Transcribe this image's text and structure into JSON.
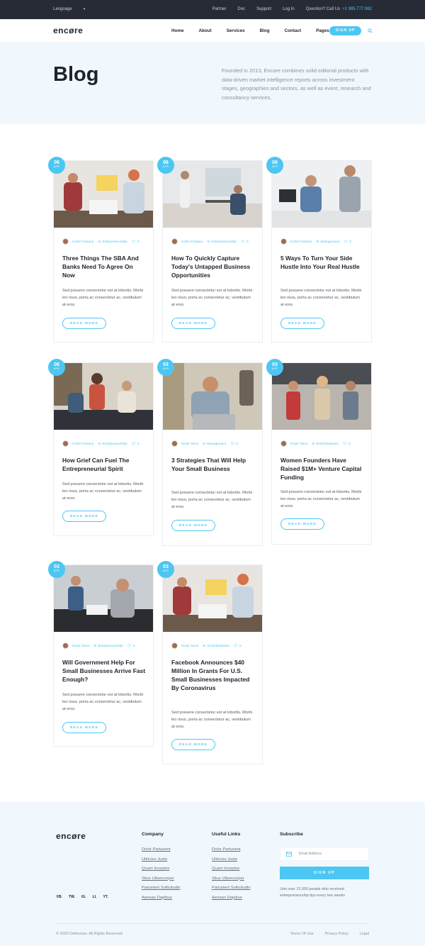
{
  "topbar": {
    "language": "Language",
    "links": [
      "Partner",
      "Doc",
      "Support",
      "Log In"
    ],
    "question": "Question? Call Us",
    "phone": "+1 985.777.982"
  },
  "header": {
    "logo": "encøre",
    "nav": [
      "Home",
      "About",
      "Services",
      "Blog",
      "Contact"
    ],
    "pages": "Pages",
    "signup": "SIGN UP"
  },
  "hero": {
    "title": "Blog",
    "description": "Founded in 2013, Encore combines solid editorial products with data-driven market intelligence reports across investment stages, geographies and sectors, as well as event, research and consultancy services."
  },
  "posts": [
    {
      "day": "06",
      "month": "APR",
      "author": "Anzhe Fontana",
      "category": "Entrepreneurship",
      "comments": "0",
      "title": "Three Things The SBA And Banks Need To Agree On Now",
      "excerpt": "Sed posuere consectetur est at lobortis. Morbi leo risus, porta ac consectetur ac, vestibulum at eros.",
      "cta": "READ MORE"
    },
    {
      "day": "06",
      "month": "APR",
      "author": "Anzhe Fontana",
      "category": "Entrepreneurship",
      "comments": "0",
      "title": "How To Quickly Capture Today's Untapped Business Opportunities",
      "excerpt": "Sed posuere consectetur est at lobortis. Morbi leo risus, porta ac consectetur ac, vestibulum at eros.",
      "cta": "READ MORE"
    },
    {
      "day": "06",
      "month": "APR",
      "author": "Anzhe Fontana",
      "category": "Management",
      "comments": "0",
      "title": "5 Ways To Turn Your Side Hustle Into Your Real Hustle",
      "excerpt": "Sed posuere consectetur est at lobortis. Morbi leo risus, porta ac consectetur ac, vestibulum at eros.",
      "cta": "READ MORE"
    },
    {
      "day": "06",
      "month": "APR",
      "author": "Anzhe Fontana",
      "category": "Entrepreneurship",
      "comments": "0",
      "title": "How Grief Can Fuel The Entrepreneurial Spirit",
      "excerpt": "Sed posuere consectetur est at lobortis. Morbi leo risus, porta ac consectetur ac, vestibulum at eros.",
      "cta": "READ MORE"
    },
    {
      "day": "03",
      "month": "APR",
      "author": "Yonas Tarus",
      "category": "Management",
      "comments": "0",
      "title": "3 Strategies That Will Help Your Small Business",
      "excerpt": "Sed posuere consectetur est at lobortis. Morbi leo risus, porta ac consectetur ac, vestibulum at eros.",
      "cta": "READ MORE"
    },
    {
      "day": "03",
      "month": "APR",
      "author": "Yonas Tarus",
      "category": "Small Business",
      "comments": "0",
      "title": "Women Founders Have Raised $1M+ Venture Capital Funding",
      "excerpt": "Sed posuere consectetur est at lobortis. Morbi leo risus, porta ac consectetur ac, vestibulum at eros.",
      "cta": "READ MORE"
    },
    {
      "day": "03",
      "month": "APR",
      "author": "Yonas Tarus",
      "category": "Entrepreneurship",
      "comments": "0",
      "title": "Will Government Help For Small Businesses Arrive Fast Enough?",
      "excerpt": "Sed posuere consectetur est at lobortis. Morbi leo risus, porta ac consectetur ac, vestibulum at eros.",
      "cta": "READ MORE"
    },
    {
      "day": "03",
      "month": "APR",
      "author": "Yonas Tarus",
      "category": "Small Business",
      "comments": "0",
      "title": "Facebook Announces $40 Million In Grants For U.S. Small Businesses Impacted By Coronavirus",
      "excerpt": "Sed posuere consectetur est at lobortis. Morbi leo risus, porta ac consectetur ac, vestibulum at eros.",
      "cta": "READ MORE"
    }
  ],
  "footer": {
    "logo": "encøre",
    "social": [
      "FB.",
      "TW.",
      "IG.",
      "LI.",
      "YT."
    ],
    "company": {
      "heading": "Company",
      "links": [
        "Dolor Parturient",
        "Ultricies Justo",
        "Quam Inceptos",
        "Situs Ullamcorper",
        "Parturient Sollicitudin",
        "Aenean Dapibus"
      ]
    },
    "useful": {
      "heading": "Useful Links",
      "links": [
        "Dolor Parturient",
        "Ultricies Justo",
        "Quam Inceptos",
        "Situs Ullamcorper",
        "Parturient Sollicitudin",
        "Aenean Dapibus"
      ]
    },
    "subscribe": {
      "heading": "Subscribe",
      "placeholder": "Email Address",
      "button": "SIGN UP",
      "note": "Join over 12,000 people who received entrepreneurship tips every two weeks"
    },
    "copyright": "© 2020 Dethemes. All Rights Reserved",
    "legal": [
      "Terms Of Use",
      "Privacy Policy",
      "Legal"
    ]
  },
  "colors": {
    "accent": "#4cc6f2",
    "dark": "#262b35",
    "hero_bg": "#f1f8fd"
  }
}
